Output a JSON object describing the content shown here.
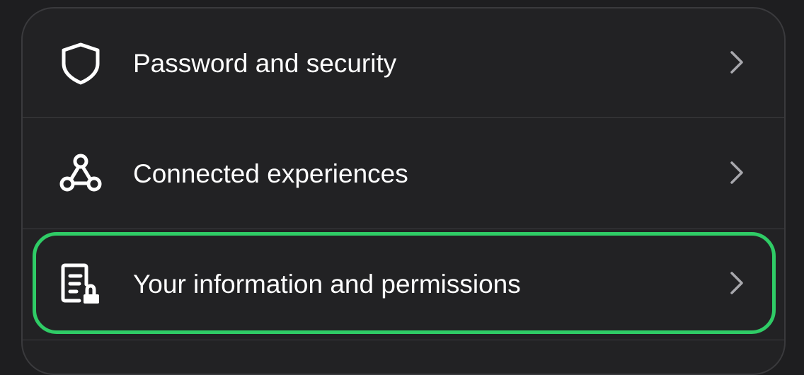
{
  "settings": {
    "items": [
      {
        "label": "Password and security",
        "icon": "shield-icon",
        "chevron": "chevron-right-icon"
      },
      {
        "label": "Connected experiences",
        "icon": "connected-nodes-icon",
        "chevron": "chevron-right-icon"
      },
      {
        "label": "Your information and permissions",
        "icon": "document-lock-icon",
        "chevron": "chevron-right-icon"
      }
    ],
    "highlight_color": "#2fcc66",
    "highlighted_item": "Your information and permissions"
  }
}
